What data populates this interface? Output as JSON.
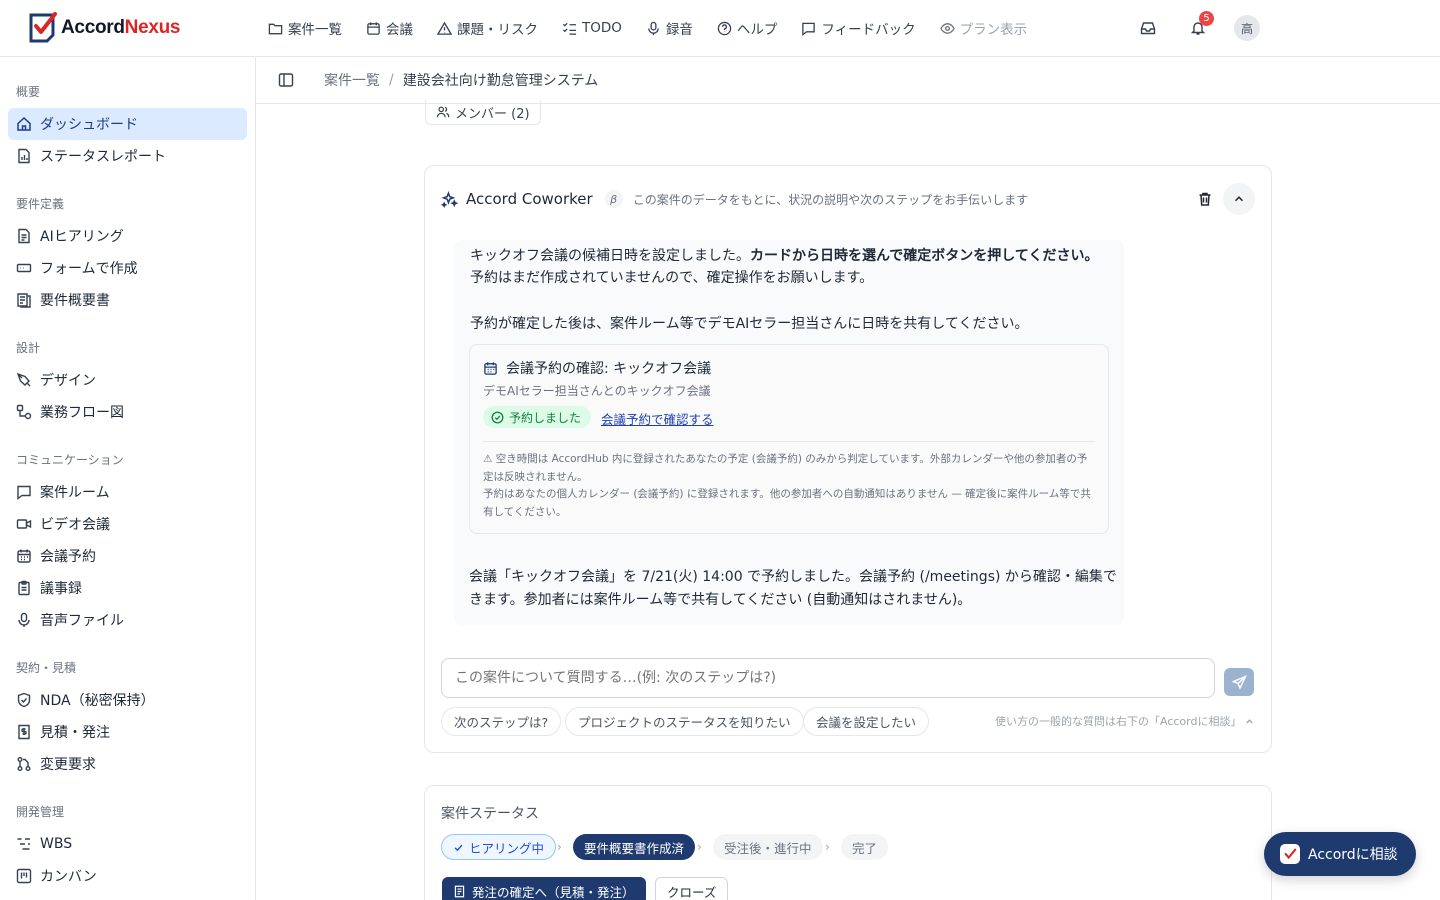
{
  "brand": {
    "name_left": "Accord",
    "name_right": "Nexus",
    "accent": "#dc2626",
    "primary": "#1e3a6e"
  },
  "nav": {
    "items": [
      {
        "label": "案件一覧",
        "icon": "folder-icon"
      },
      {
        "label": "会議",
        "icon": "calendar-icon"
      },
      {
        "label": "課題・リスク",
        "icon": "warning-icon"
      },
      {
        "label": "TODO",
        "icon": "checklist-icon"
      },
      {
        "label": "録音",
        "icon": "microphone-icon"
      },
      {
        "label": "ヘルプ",
        "icon": "help-icon"
      },
      {
        "label": "フィードバック",
        "icon": "message-icon"
      },
      {
        "label": "プラン表示",
        "icon": "eye-icon"
      }
    ],
    "notification_count": "5",
    "avatar_initial": "高"
  },
  "sidebar": {
    "sections": [
      {
        "title": "概要",
        "items": [
          {
            "label": "ダッシュボード",
            "icon": "home-icon",
            "active": true
          },
          {
            "label": "ステータスレポート",
            "icon": "report-icon"
          }
        ]
      },
      {
        "title": "要件定義",
        "items": [
          {
            "label": "AIヒアリング",
            "icon": "document-icon"
          },
          {
            "label": "フォームで作成",
            "icon": "form-icon"
          },
          {
            "label": "要件概要書",
            "icon": "list-document-icon"
          }
        ]
      },
      {
        "title": "設計",
        "items": [
          {
            "label": "デザイン",
            "icon": "pen-icon"
          },
          {
            "label": "業務フロー図",
            "icon": "flow-icon"
          }
        ]
      },
      {
        "title": "コミュニケーション",
        "items": [
          {
            "label": "案件ルーム",
            "icon": "chat-icon"
          },
          {
            "label": "ビデオ会議",
            "icon": "video-icon"
          },
          {
            "label": "会議予約",
            "icon": "calendar-icon"
          },
          {
            "label": "議事録",
            "icon": "clipboard-icon"
          },
          {
            "label": "音声ファイル",
            "icon": "microphone-icon"
          }
        ]
      },
      {
        "title": "契約・見積",
        "items": [
          {
            "label": "NDA（秘密保持）",
            "icon": "shield-icon"
          },
          {
            "label": "見積・発注",
            "icon": "receipt-icon"
          },
          {
            "label": "変更要求",
            "icon": "git-icon"
          }
        ]
      },
      {
        "title": "開発管理",
        "items": [
          {
            "label": "WBS",
            "icon": "wbs-icon"
          },
          {
            "label": "カンバン",
            "icon": "kanban-icon"
          }
        ]
      }
    ]
  },
  "breadcrumb": {
    "parent": "案件一覧",
    "current": "建設会社向け勤怠管理システム"
  },
  "members_label": "メンバー (2)",
  "coworker": {
    "title": "Accord Coworker",
    "beta": "β",
    "subtitle": "この案件のデータをもとに、状況の説明や次のステップをお手伝いします",
    "message": {
      "line1_a": "キックオフ会議の候補日時を設定しました。",
      "line1_b": "カードから日時を選んで確定ボタンを押してください。",
      "line2": "予約はまだ作成されていませんので、確定操作をお願いします。",
      "line3": "予約が確定した後は、案件ルーム等でデモAIセラー担当さんに日時を共有してください。",
      "line4": "会議「キックオフ会議」を 7/21(火) 14:00 で予約しました。会議予約 (/meetings) から確認・編集できます。参加者には案件ルーム等で共有してください (自動通知はされません)。"
    },
    "card": {
      "title": "会議予約の確認: キックオフ会議",
      "subtitle": "デモAIセラー担当さんとのキックオフ会議",
      "status": "予約しました",
      "link": "会議予約で確認する",
      "note1": "⚠ 空き時間は AccordHub 内に登録されたあなたの予定 (会議予約) のみから判定しています。外部カレンダーや他の参加者の予定は反映されません。",
      "note2": "予約はあなたの個人カレンダー (会議予約) に登録されます。他の参加者への自動通知はありません — 確定後に案件ルーム等で共有してください。"
    },
    "input_placeholder": "この案件について質問する…(例: 次のステップは?)",
    "suggestions": [
      "次のステップは?",
      "プロジェクトのステータスを知りたい",
      "会議を設定したい"
    ],
    "hint": "使い方の一般的な質問は右下の「Accordに相談」"
  },
  "status": {
    "title": "案件ステータス",
    "steps": [
      {
        "label": "ヒアリング中",
        "state": "done"
      },
      {
        "label": "要件概要書作成済",
        "state": "current"
      },
      {
        "label": "受注後・進行中",
        "state": "todo"
      },
      {
        "label": "完了",
        "state": "todo"
      }
    ],
    "primary_action": "発注の確定へ（見積・発注）",
    "secondary_action": "クローズ"
  },
  "consult_button": "Accordに相談"
}
